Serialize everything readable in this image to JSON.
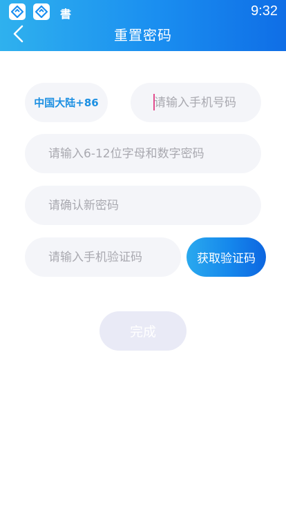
{
  "status_bar": {
    "time": "9:32",
    "glyph": "書",
    "icons": [
      "app-logo-icon",
      "app-logo-icon"
    ]
  },
  "header": {
    "title": "重置密码",
    "back_icon": "chevron-left-icon"
  },
  "form": {
    "region_label": "中国大陆+86",
    "phone_placeholder": "请输入手机号码",
    "password_placeholder": "请输入6-12位字母和数字密码",
    "confirm_placeholder": "请确认新密码",
    "code_placeholder": "请输入手机验证码",
    "get_code_label": "获取验证码",
    "submit_label": "完成"
  },
  "colors": {
    "header_start": "#2fb1ee",
    "header_end": "#0f6ee6",
    "region_text": "#1b8fe2",
    "field_bg": "#f4f5f9",
    "submit_bg": "#e9eaf6",
    "caret": "#e24b8d"
  }
}
